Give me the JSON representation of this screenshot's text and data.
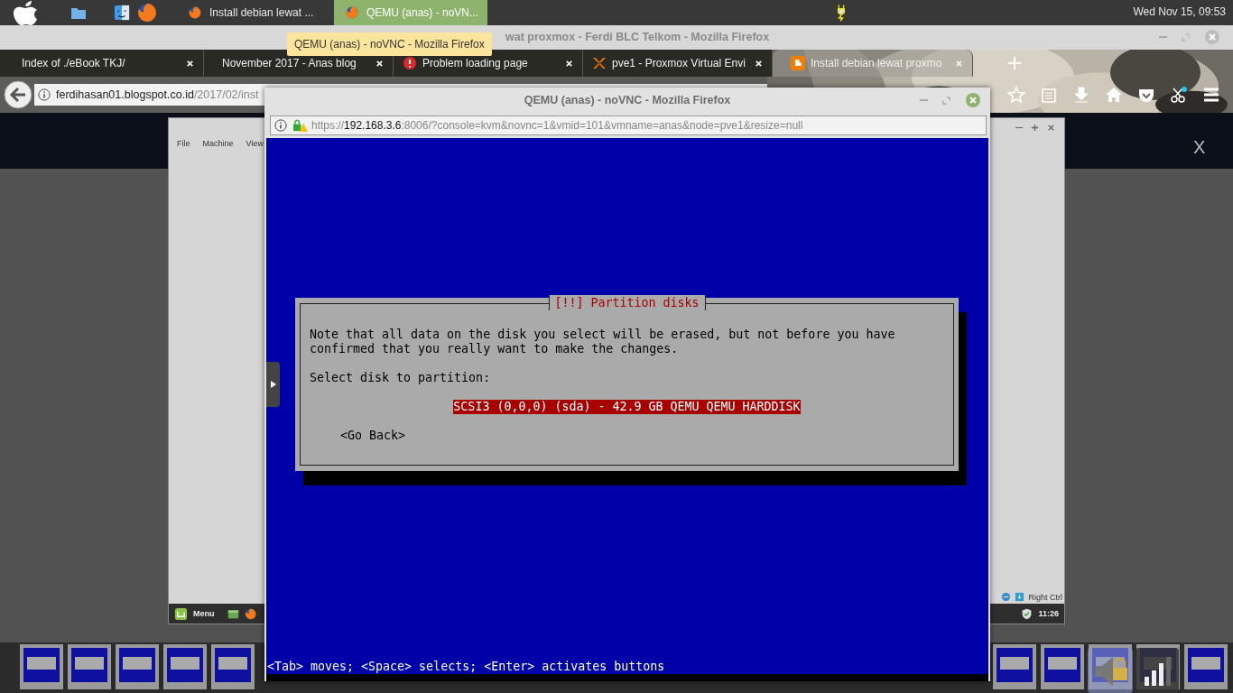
{
  "top_panel": {
    "taskbar": [
      {
        "label": "Install debian lewat ...",
        "selected": false
      },
      {
        "label": "QEMU (anas) - noVN...",
        "selected": true
      }
    ],
    "clock": "Wed Nov 15, 09:53"
  },
  "tooltip": "QEMU (anas) - noVNC - Mozilla Firefox",
  "browser": {
    "title": "wat proxmox - Ferdi BLC Telkom - Mozilla Firefox",
    "tabs": [
      {
        "label": "Index of ./eBook TKJ/",
        "selected": false,
        "kind": "plain"
      },
      {
        "label": "November 2017 - Anas blog",
        "selected": false,
        "kind": "plain"
      },
      {
        "label": "Problem loading page",
        "selected": false,
        "kind": "error"
      },
      {
        "label": "pve1 - Proxmox Virtual Envi",
        "selected": false,
        "kind": "proxmox"
      },
      {
        "label": "Install debian lewat proxmo",
        "selected": true,
        "kind": "blogger"
      }
    ],
    "url_host": "ferdihasan01.blogspot.co.id",
    "url_path": "/2017/02/inst",
    "page_close": "X"
  },
  "vm_window": {
    "menu": [
      "File",
      "Machine",
      "View"
    ],
    "host_key": "Right Ctrl",
    "start_label": "Menu",
    "time": "11:26"
  },
  "popup": {
    "title": "QEMU (anas) - noVNC - Mozilla Firefox",
    "url_scheme": "https://",
    "url_host": "192.168.3.6",
    "url_rest": ":8006/?console=kvm&novnc=1&vmid=101&vmname=anas&node=pve1&resize=null"
  },
  "installer": {
    "title": "[!!] Partition disks",
    "message": "Note that all data on the disk you select will be erased, but not before you have\nconfirmed that you really want to make the changes.",
    "prompt": "Select disk to partition:",
    "options": [
      {
        "label": "SCSI3 (0,0,0) (sda) - 42.9 GB QEMU QEMU HARDDISK",
        "selected": true
      }
    ],
    "back_button": "<Go Back>",
    "help": "<Tab> moves; <Space> selects; <Enter> activates buttons"
  }
}
